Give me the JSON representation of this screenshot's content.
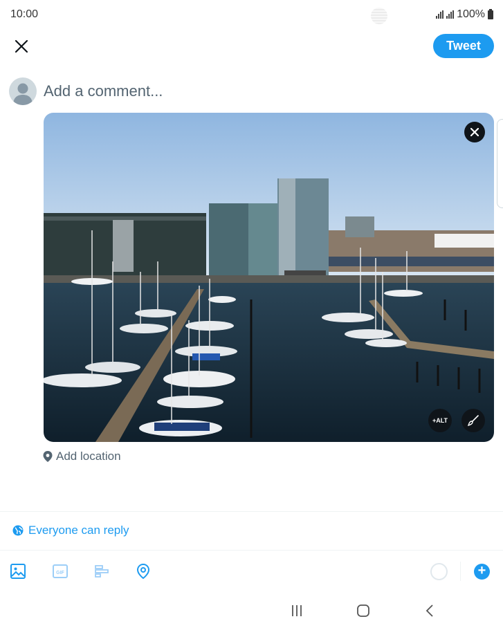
{
  "status_bar": {
    "time": "10:00",
    "battery": "100%"
  },
  "header": {
    "tweet_label": "Tweet"
  },
  "composer": {
    "placeholder": "Add a comment..."
  },
  "media": {
    "alt_label": "+ALT"
  },
  "location": {
    "label": "Add location"
  },
  "reply_settings": {
    "label": "Everyone can reply"
  },
  "toolbar": {
    "icons": [
      "image-icon",
      "gif-icon",
      "poll-icon",
      "location-pin-icon"
    ],
    "gif_text": "GIF"
  },
  "colors": {
    "accent": "#1d9bf0",
    "text_secondary": "#536471",
    "dark": "#0f1419"
  }
}
